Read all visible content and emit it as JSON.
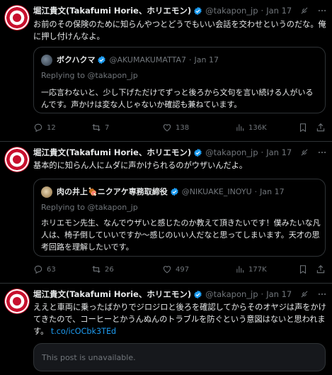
{
  "tweets": [
    {
      "name": "堀江貴文(Takafumi Horie、ホリエモン)",
      "handle": "@takapon_jp",
      "sep": "·",
      "date": "Jan 17",
      "text": "お前のその保険のために知らんやつとどうでもいい会話を交わせというのだな。俺に押し付けんなよ。",
      "quote": {
        "name": "ボクハクマ",
        "handle": "@AKUMAKUMATTA7",
        "sep": "·",
        "date": "Jan 17",
        "reply": "Replying to @takapon_jp",
        "text": "一応言わないと、少し下げただけでずっと後ろから文句を言い続ける人がいるんです。声かけは変な人じゃないか確認も兼ねています。"
      },
      "stats": {
        "replies": "12",
        "retweets": "7",
        "likes": "138",
        "views": "136K"
      }
    },
    {
      "name": "堀江貴文(Takafumi Horie、ホリエモン)",
      "handle": "@takapon_jp",
      "sep": "·",
      "date": "Jan 17",
      "text": "基本的に知らん人にムダに声かけられるのがウザいんだよ。",
      "quote": {
        "name": "肉の井上🍖ニクアケ専務取締役",
        "handle": "@NIKUAKE_INOYU",
        "sep": "·",
        "date": "Jan 17",
        "reply": "Replying to @takapon_jp",
        "text": "ホリエモン先生、なんでウザいと感じたのか教えて頂きたいです！僕みたいな凡人は、椅子倒していいですか〜感じのいい人だなと思ってしまいます。天才の思考回路を理解したいです。"
      },
      "stats": {
        "replies": "63",
        "retweets": "26",
        "likes": "497",
        "views": "177K"
      }
    },
    {
      "name": "堀江貴文(Takafumi Horie、ホリエモン)",
      "handle": "@takapon_jp",
      "sep": "·",
      "date": "Jan 17",
      "text": "ええと車両に乗ったばかりでジロジロと後ろを確認してからそのオヤジは声をかけてきたので、コーヒーとかうんぬんのトラブルを防ぐという意図はないと思われます。",
      "link": "t.co/icOCbk3TEd",
      "unavailable": "This post is unavailable."
    }
  ],
  "colors": {
    "bg": "#000000",
    "text": "#e7e9ea",
    "muted": "#71767b",
    "link": "#1d9bf0",
    "border": "#2f3336",
    "verified": "#1d9bf0"
  }
}
